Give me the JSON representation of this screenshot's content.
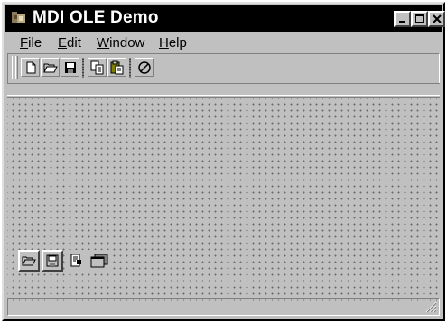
{
  "window": {
    "title": "MDI OLE Demo",
    "controls": {
      "minimize": "_",
      "maximize": "□",
      "close": "×"
    }
  },
  "menu": [
    {
      "mnemonic": "F",
      "rest": "ile"
    },
    {
      "mnemonic": "E",
      "rest": "dit"
    },
    {
      "mnemonic": "W",
      "rest": "indow"
    },
    {
      "mnemonic": "H",
      "rest": "elp"
    }
  ],
  "toolbar": {
    "buttons": [
      "new-document-icon",
      "open-folder-icon",
      "save-disk-icon",
      "copy-icon",
      "paste-icon",
      "stop-icon"
    ]
  },
  "floating_toolbar": {
    "buttons": [
      "open-folder-icon",
      "save-disk-icon",
      "properties-icon",
      "window-icon"
    ]
  },
  "status": {
    "text": ""
  }
}
